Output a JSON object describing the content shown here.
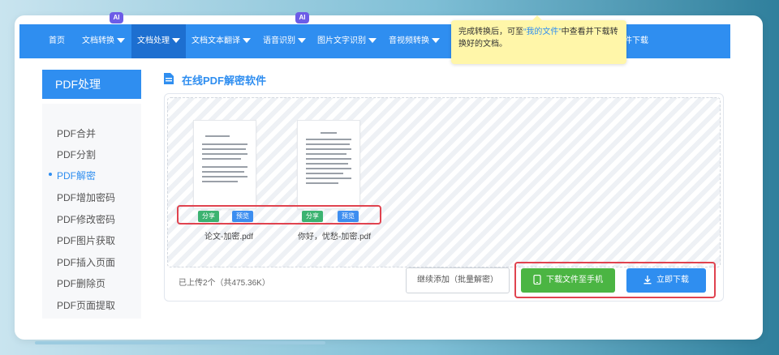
{
  "nav": {
    "items": [
      {
        "label": "首页"
      },
      {
        "label": "文档转换"
      },
      {
        "label": "文档处理"
      },
      {
        "label": "文档文本翻译"
      },
      {
        "label": "语音识别"
      },
      {
        "label": "图片文字识别"
      },
      {
        "label": "音视频转换"
      },
      {
        "label": "件下载"
      }
    ],
    "ai_badge": "AI"
  },
  "tooltip": {
    "text_before": "完成转换后，可至",
    "link": "“我的文件”",
    "text_after": "中查看并下载转换好的文档。"
  },
  "sidebar": {
    "title": "PDF处理",
    "items": [
      {
        "label": "PDF合并"
      },
      {
        "label": "PDF分割"
      },
      {
        "label": "PDF解密"
      },
      {
        "label": "PDF增加密码"
      },
      {
        "label": "PDF修改密码"
      },
      {
        "label": "PDF图片获取"
      },
      {
        "label": "PDF插入页面"
      },
      {
        "label": "PDF删除页"
      },
      {
        "label": "PDF页面提取"
      }
    ]
  },
  "page": {
    "title": "在线PDF解密软件"
  },
  "files": [
    {
      "name": "论文-加密.pdf",
      "share": "分享",
      "preview": "预览"
    },
    {
      "name": "你好，忧愁-加密.pdf",
      "share": "分享",
      "preview": "预览"
    }
  ],
  "footer": {
    "status": "已上传2个（共475.36K）",
    "continue_label": "继续添加（批量解密）",
    "phone_label": "下载文件至手机",
    "download_label": "立即下载"
  },
  "colors": {
    "primary": "#2f8ef0",
    "success": "#4bb543",
    "highlight": "#e0434f"
  }
}
